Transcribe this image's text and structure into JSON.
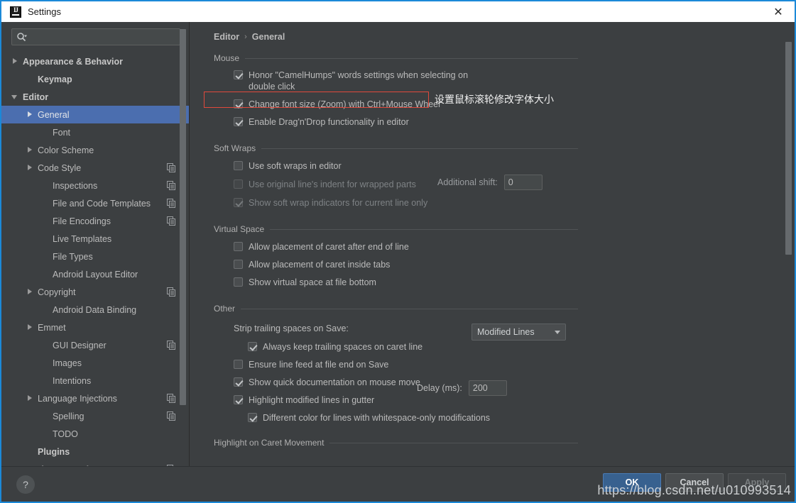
{
  "window": {
    "title": "Settings",
    "logo_icon": "intellij-idea-logo",
    "close_icon": "close-icon"
  },
  "search": {
    "icon": "search-icon",
    "value": "",
    "placeholder": ""
  },
  "sidebar": {
    "items": [
      {
        "label": "Appearance & Behavior",
        "arrow": "right",
        "bold": true,
        "indent": 0,
        "copy": false,
        "selected": false
      },
      {
        "label": "Keymap",
        "arrow": "none",
        "bold": true,
        "indent": 1,
        "copy": false,
        "selected": false
      },
      {
        "label": "Editor",
        "arrow": "down",
        "bold": true,
        "indent": 0,
        "copy": false,
        "selected": false
      },
      {
        "label": "General",
        "arrow": "right",
        "bold": false,
        "indent": 1,
        "copy": false,
        "selected": true
      },
      {
        "label": "Font",
        "arrow": "none",
        "bold": false,
        "indent": 2,
        "copy": false,
        "selected": false
      },
      {
        "label": "Color Scheme",
        "arrow": "right",
        "bold": false,
        "indent": 1,
        "copy": false,
        "selected": false
      },
      {
        "label": "Code Style",
        "arrow": "right",
        "bold": false,
        "indent": 1,
        "copy": true,
        "selected": false
      },
      {
        "label": "Inspections",
        "arrow": "none",
        "bold": false,
        "indent": 2,
        "copy": true,
        "selected": false
      },
      {
        "label": "File and Code Templates",
        "arrow": "none",
        "bold": false,
        "indent": 2,
        "copy": true,
        "selected": false
      },
      {
        "label": "File Encodings",
        "arrow": "none",
        "bold": false,
        "indent": 2,
        "copy": true,
        "selected": false
      },
      {
        "label": "Live Templates",
        "arrow": "none",
        "bold": false,
        "indent": 2,
        "copy": false,
        "selected": false
      },
      {
        "label": "File Types",
        "arrow": "none",
        "bold": false,
        "indent": 2,
        "copy": false,
        "selected": false
      },
      {
        "label": "Android Layout Editor",
        "arrow": "none",
        "bold": false,
        "indent": 2,
        "copy": false,
        "selected": false
      },
      {
        "label": "Copyright",
        "arrow": "right",
        "bold": false,
        "indent": 1,
        "copy": true,
        "selected": false
      },
      {
        "label": "Android Data Binding",
        "arrow": "none",
        "bold": false,
        "indent": 2,
        "copy": false,
        "selected": false
      },
      {
        "label": "Emmet",
        "arrow": "right",
        "bold": false,
        "indent": 1,
        "copy": false,
        "selected": false
      },
      {
        "label": "GUI Designer",
        "arrow": "none",
        "bold": false,
        "indent": 2,
        "copy": true,
        "selected": false
      },
      {
        "label": "Images",
        "arrow": "none",
        "bold": false,
        "indent": 2,
        "copy": false,
        "selected": false
      },
      {
        "label": "Intentions",
        "arrow": "none",
        "bold": false,
        "indent": 2,
        "copy": false,
        "selected": false
      },
      {
        "label": "Language Injections",
        "arrow": "right",
        "bold": false,
        "indent": 1,
        "copy": true,
        "selected": false
      },
      {
        "label": "Spelling",
        "arrow": "none",
        "bold": false,
        "indent": 2,
        "copy": true,
        "selected": false
      },
      {
        "label": "TODO",
        "arrow": "none",
        "bold": false,
        "indent": 2,
        "copy": false,
        "selected": false
      },
      {
        "label": "Plugins",
        "arrow": "none",
        "bold": true,
        "indent": 1,
        "copy": false,
        "selected": false
      },
      {
        "label": "Version Control",
        "arrow": "right",
        "bold": true,
        "indent": 0,
        "copy": true,
        "selected": false
      }
    ]
  },
  "breadcrumb": {
    "root": "Editor",
    "separator": "›",
    "current": "General"
  },
  "groups": {
    "mouse": {
      "title": "Mouse",
      "options": [
        {
          "label": "Honor \"CamelHumps\" words settings when selecting on double click",
          "checked": true,
          "enabled": true
        },
        {
          "label": "Change font size (Zoom) with Ctrl+Mouse Wheel",
          "checked": true,
          "enabled": true
        },
        {
          "label": "Enable Drag'n'Drop functionality in editor",
          "checked": true,
          "enabled": true
        }
      ]
    },
    "soft_wraps": {
      "title": "Soft Wraps",
      "options": [
        {
          "label": "Use soft wraps in editor",
          "checked": false,
          "enabled": true
        },
        {
          "label": "Use original line's indent for wrapped parts",
          "checked": false,
          "enabled": false
        },
        {
          "label": "Show soft wrap indicators for current line only",
          "checked": true,
          "enabled": false
        }
      ],
      "additional_shift_label": "Additional shift:",
      "additional_shift_value": "0"
    },
    "virtual_space": {
      "title": "Virtual Space",
      "options": [
        {
          "label": "Allow placement of caret after end of line",
          "checked": false,
          "enabled": true
        },
        {
          "label": "Allow placement of caret inside tabs",
          "checked": false,
          "enabled": true
        },
        {
          "label": "Show virtual space at file bottom",
          "checked": false,
          "enabled": true
        }
      ]
    },
    "other": {
      "title": "Other",
      "strip_label": "Strip trailing spaces on Save:",
      "strip_value": "Modified Lines",
      "options": [
        {
          "label": "Always keep trailing spaces on caret line",
          "checked": true,
          "enabled": true,
          "indent": 2
        },
        {
          "label": "Ensure line feed at file end on Save",
          "checked": false,
          "enabled": true,
          "indent": 1
        },
        {
          "label": "Show quick documentation on mouse move",
          "checked": true,
          "enabled": true,
          "indent": 1
        },
        {
          "label": "Highlight modified lines in gutter",
          "checked": true,
          "enabled": true,
          "indent": 1
        },
        {
          "label": "Different color for lines with whitespace-only modifications",
          "checked": true,
          "enabled": true,
          "indent": 2
        }
      ],
      "delay_label": "Delay (ms):",
      "delay_value": "200"
    },
    "highlight_caret": {
      "title": "Highlight on Caret Movement"
    }
  },
  "annotation": {
    "text": "设置鼠标滚轮修改字体大小",
    "box_color": "#e0493c"
  },
  "footer": {
    "help_icon": "help-question-icon",
    "ok": "OK",
    "cancel": "Cancel",
    "apply": "Apply"
  },
  "watermark": "https://blog.csdn.net/u010993514",
  "colors": {
    "background": "#3c3f41",
    "selection": "#4b6eaf",
    "accent_border": "#1b89d8",
    "primary_button": "#38618f"
  }
}
